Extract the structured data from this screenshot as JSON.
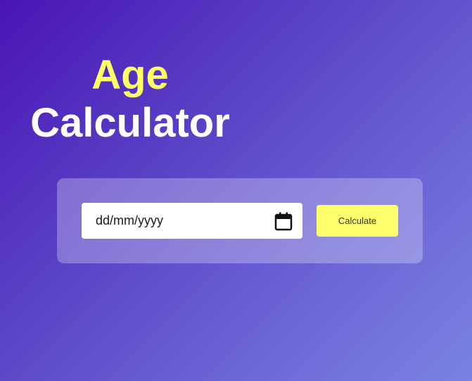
{
  "title": {
    "line1": "Age",
    "line2": "Calculator"
  },
  "form": {
    "date_placeholder": "dd/mm/yyyy",
    "button_label": "Calculate"
  },
  "icons": {
    "date_picker": "calendar-icon"
  },
  "colors": {
    "accent_yellow": "#ffff66",
    "button_yellow": "#ffff6e",
    "title_white": "#ffffff",
    "gradient_start": "#4a14b5",
    "gradient_end": "#7a82e2"
  }
}
